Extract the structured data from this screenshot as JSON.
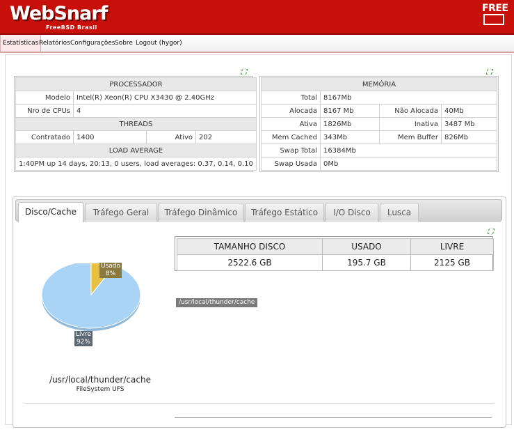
{
  "header": {
    "logo": "WebSnarf",
    "logo_sub": "FreeBSD Brasil",
    "badge": "FREE"
  },
  "nav": {
    "items": [
      "Estatísticas",
      "Relatórios",
      "Configurações",
      "Sobre",
      "Logout (hygor)"
    ],
    "active": 0
  },
  "processador": {
    "title": "PROCESSADOR",
    "modelo_label": "Modelo",
    "modelo": "Intel(R) Xeon(R) CPU X3430 @ 2.40GHz",
    "cpus_label": "Nro de CPUs",
    "cpus": "4",
    "threads_title": "THREADS",
    "contratado_label": "Contratado",
    "contratado": "1400",
    "ativo_label": "Ativo",
    "ativo": "202",
    "load_title": "LOAD AVERAGE",
    "load": "1:40PM up 14 days, 20:13, 0 users, load averages: 0.37, 0.14, 0.10"
  },
  "memoria": {
    "title": "MEMÓRIA",
    "total_label": "Total",
    "total": "8167Mb",
    "alocada_label": "Alocada",
    "alocada": "8167 Mb",
    "nao_alocada_label": "Não Alocada",
    "nao_alocada": "40Mb",
    "ativa_label": "Ativa",
    "ativa": "1826Mb",
    "inativa_label": "Inativa",
    "inativa": "3487 Mb",
    "cached_label": "Mem Cached",
    "cached": "343Mb",
    "buffer_label": "Mem Buffer",
    "buffer": "826Mb",
    "swap_total_label": "Swap Total",
    "swap_total": "16384Mb",
    "swap_usada_label": "Swap Usada",
    "swap_usada": "0Mb"
  },
  "tabs": [
    "Disco/Cache",
    "Tráfego Geral",
    "Tráfego Dinâmico",
    "Tráfego Estático",
    "I/O Disco",
    "Lusca"
  ],
  "active_tab": 0,
  "disk": {
    "headers": [
      "TAMANHO DISCO",
      "USADO",
      "LIVRE"
    ],
    "values": [
      "2522.6 GB",
      "195.7 GB",
      "2125 GB"
    ],
    "path_label": "/usr/local/thunder/cache"
  },
  "chart_data": {
    "type": "pie",
    "slices": [
      {
        "label": "Usado",
        "value": 8,
        "display": "8%",
        "color": "#e8c040"
      },
      {
        "label": "Livre",
        "value": 92,
        "display": "92%",
        "color": "#a9d4f5"
      }
    ],
    "title": "/usr/local/thunder/cache",
    "subtitle": "FileSystem UFS"
  },
  "colors": {
    "header_red": "#c8100b",
    "pie_free": "#a9d4f5",
    "pie_used": "#e8c040"
  },
  "icons": {
    "refresh": "refresh-icon"
  }
}
